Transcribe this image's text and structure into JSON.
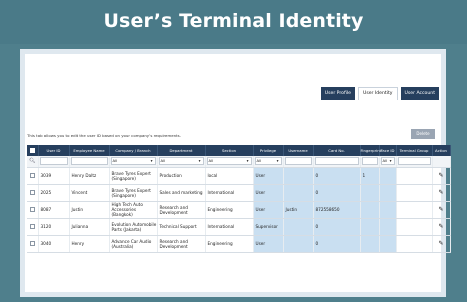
{
  "banner": {
    "title": "User’s Terminal Identity"
  },
  "tabs": [
    {
      "label": "User Profile",
      "active": false
    },
    {
      "label": "User Identity",
      "active": true
    },
    {
      "label": "User Account",
      "active": false
    }
  ],
  "description": "This tab allows you to edit the user ID based on your company’s requirements.",
  "delete_label": "Delete",
  "table": {
    "headers": [
      "User ID",
      "Employee Name",
      "Company / Branch",
      "Department",
      "Section",
      "Privilege",
      "Username",
      "Card No.",
      "Fingerprint",
      "Face ID",
      "Terminal Group",
      "Action"
    ],
    "filter": {
      "company": "All",
      "department": "All",
      "section": "All",
      "privilege": "All",
      "face_id": "All"
    },
    "rows": [
      {
        "user_id": "3039",
        "name": "Henry Daltz",
        "company": "Brave Tyres Expert (Singapore)",
        "department": "Production",
        "section": "local",
        "privilege": "User",
        "username": "",
        "card": "0",
        "fingerprint": "1",
        "face_id": "",
        "terminal_group": ""
      },
      {
        "user_id": "2025",
        "name": "Vincent",
        "company": "Brave Tyres Expert (Singapore)",
        "department": "Sales and marketing",
        "section": "International",
        "privilege": "User",
        "username": "",
        "card": "0",
        "fingerprint": "",
        "face_id": "",
        "terminal_group": ""
      },
      {
        "user_id": "8087",
        "name": "Justin",
        "company": "High Tech Auto Accessories (Bangkok)",
        "department": "Research and Development",
        "section": "Engineering",
        "privilege": "User",
        "username": "Justin",
        "card": "872558650",
        "fingerprint": "",
        "face_id": "",
        "terminal_group": ""
      },
      {
        "user_id": "3120",
        "name": "Julianna",
        "company": "Evolution Automobile Parts (Jakarta)",
        "department": "Technical Support",
        "section": "International",
        "privilege": "Supervisor",
        "username": "",
        "card": "0",
        "fingerprint": "",
        "face_id": "",
        "terminal_group": ""
      },
      {
        "user_id": "3040",
        "name": "Henry",
        "company": "Advance Car Audio (Australia)",
        "department": "Research and Development",
        "section": "Engineering",
        "privilege": "User",
        "username": "",
        "card": "0",
        "fingerprint": "",
        "face_id": "",
        "terminal_group": ""
      }
    ]
  },
  "colors": {
    "banner": "#4a7a88",
    "header": "#263f5e",
    "highlight": "#c9dff1",
    "frame": "#dfe8ef"
  },
  "icons": {
    "search": "search-icon",
    "edit": "pencil-icon",
    "dropdown": "chevron-down-icon"
  }
}
